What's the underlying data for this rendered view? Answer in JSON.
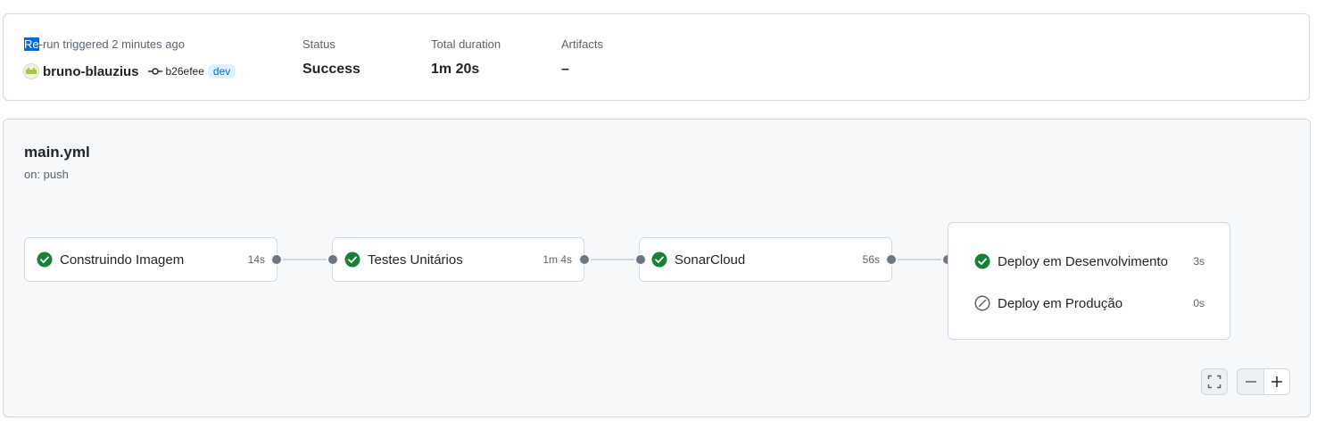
{
  "run": {
    "trigger_highlight": "Re",
    "trigger_rest": "-run triggered 2 minutes ago",
    "actor": "bruno-blauzius",
    "commit_sha": "b26efee",
    "branch": "dev",
    "status_label": "Status",
    "status_value": "Success",
    "duration_label": "Total duration",
    "duration_value": "1m 20s",
    "artifacts_label": "Artifacts",
    "artifacts_value": "–"
  },
  "workflow": {
    "name": "main.yml",
    "trigger": "on: push"
  },
  "jobs": [
    {
      "name": "Construindo Imagem",
      "duration": "14s",
      "status": "success",
      "icon": "check-circle-icon"
    },
    {
      "name": "Testes Unitários",
      "duration": "1m 4s",
      "status": "success",
      "icon": "check-circle-icon"
    },
    {
      "name": "SonarCloud",
      "duration": "56s",
      "status": "success",
      "icon": "check-circle-icon"
    }
  ],
  "deploy_group": [
    {
      "name": "Deploy em Desenvolvimento",
      "duration": "3s",
      "status": "success",
      "icon": "check-circle-icon"
    },
    {
      "name": "Deploy em Produção",
      "duration": "0s",
      "status": "skipped",
      "icon": "skip-icon"
    }
  ],
  "controls": {
    "fullscreen_icon": "fullscreen-icon",
    "zoom_out_icon": "minus-icon",
    "zoom_in_icon": "plus-icon"
  },
  "colors": {
    "success": "#1a7f37",
    "muted": "#59636e",
    "accent": "#0969da"
  }
}
